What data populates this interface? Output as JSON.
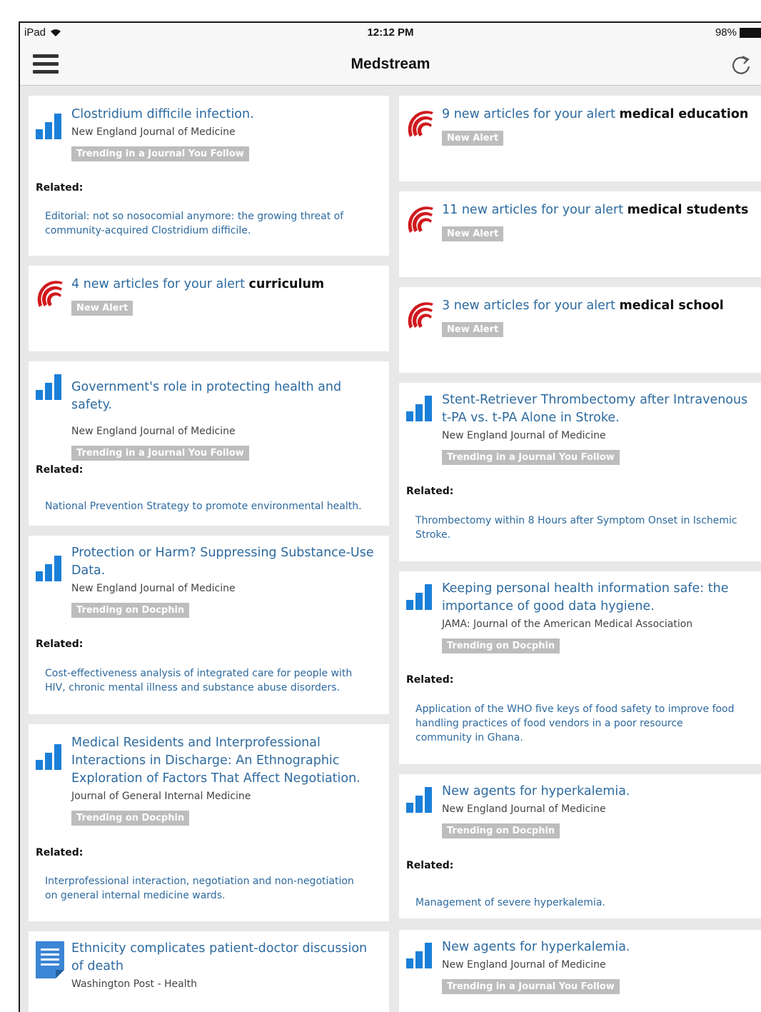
{
  "status_bar": {
    "device": "iPad",
    "time": "12:12 PM",
    "battery": "98%"
  },
  "nav": {
    "title": "Medstream"
  },
  "related_label": "Related:",
  "cards": {
    "c1": {
      "title": "Clostridium difficile infection.",
      "source": "New England Journal of Medicine",
      "tag": "Trending in a Journal You Follow",
      "related": "Editorial: not so nosocomial anymore: the growing threat of community-acquired Clostridium difficile."
    },
    "c2": {
      "title": "4 new articles for your alert ",
      "keyword": "curriculum",
      "tag": "New Alert"
    },
    "c3": {
      "title": "Government's role in protecting health and safety.",
      "source": "New England Journal of Medicine",
      "tag": "Trending in a Journal You Follow",
      "related": "National Prevention Strategy to promote environmental health."
    },
    "c4": {
      "title": "Protection or Harm? Suppressing Substance-Use Data.",
      "source": "New England Journal of Medicine",
      "tag": "Trending on Docphin",
      "related": "Cost-effectiveness analysis of integrated care for people with HIV, chronic mental illness and substance abuse disorders."
    },
    "c5": {
      "title": "Medical Residents and Interprofessional Interactions in Discharge: An Ethnographic Exploration of Factors That Affect Negotiation.",
      "source": "Journal of General Internal Medicine",
      "tag": "Trending on Docphin",
      "related": "Interprofessional interaction, negotiation and non-negotiation on general internal medicine wards."
    },
    "c6": {
      "title": "Ethnicity complicates patient-doctor discussion of death",
      "source": "Washington Post - Health"
    },
    "c7": {
      "title": "9 new articles for your alert ",
      "keyword": "medical education",
      "tag": "New Alert"
    },
    "c8": {
      "title": "11 new articles for your alert ",
      "keyword": "medical students",
      "tag": "New Alert"
    },
    "c9": {
      "title": "3 new articles for your alert ",
      "keyword": "medical school",
      "tag": "New Alert"
    },
    "c10": {
      "title": "Stent-Retriever Thrombectomy after Intravenous t-PA vs. t-PA Alone in Stroke.",
      "source": "New England Journal of Medicine",
      "tag": "Trending in a Journal You Follow",
      "related": "Thrombectomy within 8 Hours after Symptom Onset in Ischemic Stroke."
    },
    "c11": {
      "title": "Keeping personal health information safe: the importance of good data hygiene.",
      "source": "JAMA: Journal of the American Medical Association",
      "tag": "Trending on Docphin",
      "related": "Application of the WHO five keys of food safety to improve food handling practices of food vendors in a poor resource community in Ghana."
    },
    "c12": {
      "title": "New agents for hyperkalemia.",
      "source": "New England Journal of Medicine",
      "tag": "Trending on Docphin",
      "related": "Management of severe hyperkalemia."
    },
    "c13": {
      "title": "New agents for hyperkalemia.",
      "source": "New England Journal of Medicine",
      "tag": "Trending in a Journal You Follow"
    }
  },
  "colors": {
    "link": "#2d6a9f",
    "bar_icon": "#1a7fd8",
    "alert_icon": "#d0191d",
    "tag_bg": "#bdbdbd"
  },
  "icons": {
    "trending": "bar-chart-icon",
    "alert": "signal-alert-icon",
    "article": "document-icon",
    "menu": "hamburger-menu-icon",
    "refresh": "refresh-icon"
  }
}
